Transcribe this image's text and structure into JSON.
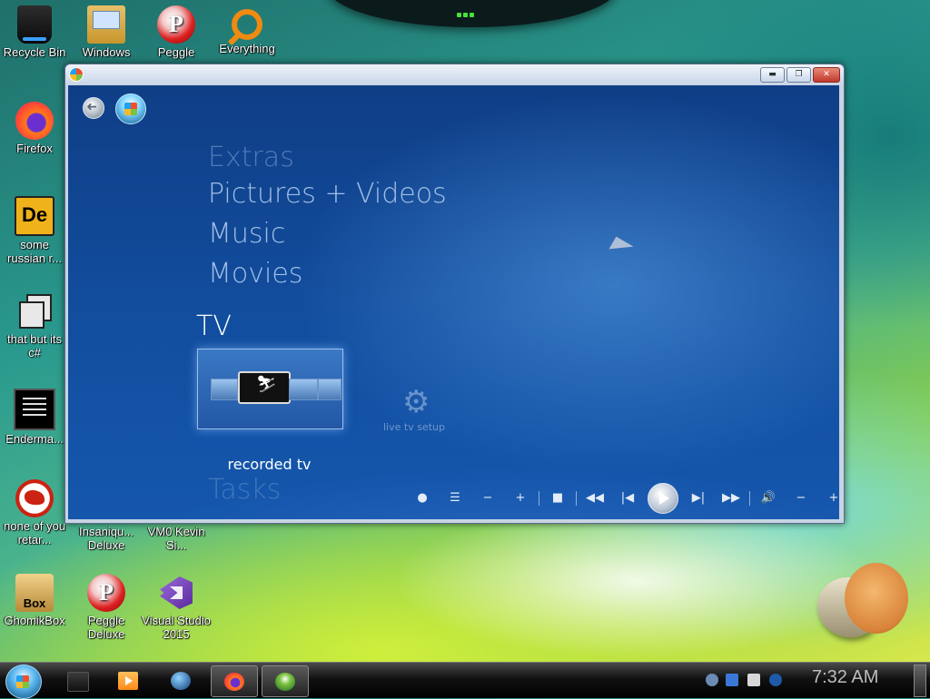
{
  "desktop": {
    "icons": [
      {
        "label": "Recycle Bin",
        "icon": "recycle-bin-icon"
      },
      {
        "label": "Windows",
        "icon": "windows-folder-icon"
      },
      {
        "label": "Peggle",
        "icon": "peggle-icon"
      },
      {
        "label": "Everything",
        "icon": "everything-search-icon"
      },
      {
        "label": "Firefox",
        "icon": "firefox-icon"
      },
      {
        "label": "some russian r...",
        "icon": "de-app-icon"
      },
      {
        "label": "that but its c#",
        "icon": "copy-windows-icon"
      },
      {
        "label": "Enderma...",
        "icon": "terminal-icon"
      },
      {
        "label": "none of you retar...",
        "icon": "dinosaur-icon"
      },
      {
        "label": "Insaniqu... Deluxe",
        "icon": "insaniquarium-icon"
      },
      {
        "label": "VM0 Kevin Si...",
        "icon": "vm-icon"
      },
      {
        "label": "GhomikBox",
        "icon": "ghomikbox-icon"
      },
      {
        "label": "Peggle Deluxe",
        "icon": "peggle-deluxe-icon"
      },
      {
        "label": "Visual Studio 2015",
        "icon": "visual-studio-icon"
      }
    ],
    "ghomikbox_badge": "Box",
    "de_badge": "De",
    "peggle_badge": "P"
  },
  "window": {
    "title": "",
    "buttons": {
      "minimize": "▬",
      "maximize": "❐",
      "close": "✕"
    }
  },
  "media_center": {
    "menu": {
      "extras": "Extras",
      "pictures": "Pictures + Videos",
      "music": "Music",
      "movies": "Movies",
      "tv": "TV",
      "tasks": "Tasks"
    },
    "tv_items": [
      {
        "label": "recorded tv",
        "selected": true
      },
      {
        "label": "live tv setup",
        "selected": false
      }
    ],
    "transport": {
      "record": "●",
      "guide": "☰",
      "channel_down": "−",
      "channel_up": "+",
      "stop": "■",
      "rewind": "◀◀",
      "skip_back": "|◀",
      "skip_forward": "▶|",
      "fast_forward": "▶▶",
      "mute": "🔊",
      "volume_down": "−",
      "volume_up": "+"
    }
  },
  "taskbar": {
    "clock": "7:32 AM",
    "buttons": [
      "explorer",
      "media-player",
      "globe",
      "firefox",
      "windows-media-center"
    ]
  },
  "colors": {
    "wmc_background": "#124e9f",
    "taskbar": "#111111",
    "close_button": "#c0392b"
  }
}
